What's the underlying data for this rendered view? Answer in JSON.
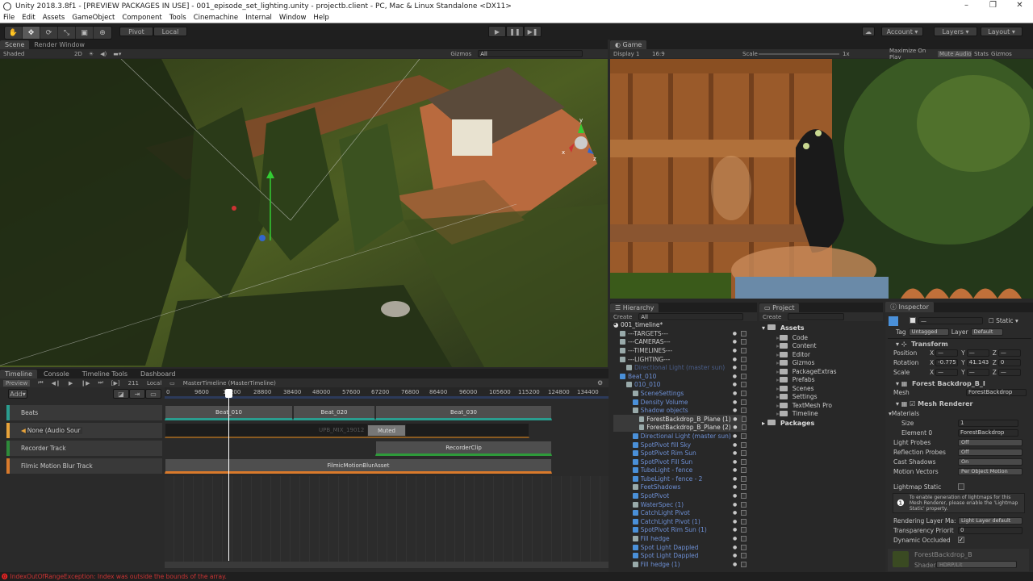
{
  "window": {
    "title": "Unity 2018.3.8f1 - [PREVIEW PACKAGES IN USE] - 001_episode_set_lighting.unity - projectb.client - PC, Mac & Linux Standalone <DX11>",
    "controls": [
      "–",
      "❐",
      "✕"
    ]
  },
  "menu": [
    "File",
    "Edit",
    "Assets",
    "GameObject",
    "Component",
    "Tools",
    "Cinemachine",
    "Internal",
    "Window",
    "Help"
  ],
  "toolbar": {
    "tools": [
      "hand",
      "move",
      "rotate",
      "scale",
      "rect",
      "transform"
    ],
    "pivot": "Pivot",
    "local": "Local",
    "play_buttons": [
      "▶",
      "❚❚",
      "▶❚"
    ],
    "account": "Account",
    "layers": "Layers",
    "layout": "Layout"
  },
  "scene": {
    "tabs": [
      "Scene",
      "Render Window"
    ],
    "shading": "Shaded",
    "mode_2d": "2D",
    "gizmos": "Gizmos",
    "search": "All",
    "axis": {
      "x": "x",
      "y": "y",
      "z": "z"
    }
  },
  "game": {
    "tab": "Game",
    "display": "Display 1",
    "aspect": "16:9",
    "scale_label": "Scale",
    "scale_value": "1x",
    "buttons": [
      "Maximize On Play",
      "Mute Audio",
      "Stats",
      "Gizmos"
    ]
  },
  "timeline": {
    "tabs": [
      "Timeline",
      "Console",
      "Timeline Tools",
      "Dashboard"
    ],
    "preview": "Preview",
    "frame": "211",
    "local": "Local",
    "asset": "MasterTimeline (MasterTimeline)",
    "add": "Add",
    "ruler": [
      "0",
      "9600",
      "19200",
      "28800",
      "38400",
      "48000",
      "57600",
      "67200",
      "76800",
      "86400",
      "96000",
      "105600",
      "115200",
      "124800",
      "134400"
    ],
    "tracks": [
      {
        "name": "Beats",
        "color": "#2a9d8f"
      },
      {
        "name": "None (Audio Sour",
        "color": "#e8a33a"
      },
      {
        "name": "Recorder Track",
        "color": "#2e8b3a"
      },
      {
        "name": "Filmic Motion Blur Track",
        "color": "#d97a2b"
      }
    ],
    "clips": {
      "beats": [
        "Beat_010",
        "Beat_020",
        "Beat_030"
      ],
      "audio": "UPB_MIX_19012",
      "muted": "Muted",
      "recorder": "RecorderClip",
      "blur": "FilmicMotionBlurAsset"
    }
  },
  "hierarchy": {
    "tab": "Hierarchy",
    "create": "Create",
    "search": "All",
    "scene": "001_timeline*",
    "items": [
      {
        "label": "---TARGETS---",
        "indent": 1,
        "style": "grey"
      },
      {
        "label": "---CAMERAS---",
        "indent": 1,
        "style": "grey"
      },
      {
        "label": "---TIMELINES---",
        "indent": 1,
        "style": "grey"
      },
      {
        "label": "---LIGHTING---",
        "indent": 1,
        "style": "grey"
      },
      {
        "label": "Directional Light (master sun)",
        "indent": 2,
        "style": "dim"
      },
      {
        "label": "Beat_010",
        "indent": 1,
        "style": "blue"
      },
      {
        "label": "010_010",
        "indent": 2,
        "style": "blue"
      },
      {
        "label": "SceneSettings",
        "indent": 3,
        "style": "blue"
      },
      {
        "label": "Density Volume",
        "indent": 3,
        "style": "blue"
      },
      {
        "label": "Shadow objects",
        "indent": 3,
        "style": "blue"
      },
      {
        "label": "ForestBackdrop_B_Plane (1)",
        "indent": 4,
        "style": "white"
      },
      {
        "label": "ForestBackdrop_B_Plane (2)",
        "indent": 4,
        "style": "white"
      },
      {
        "label": "Directional Light (master sun)",
        "indent": 3,
        "style": "blue"
      },
      {
        "label": "SpotPivot fill Sky",
        "indent": 3,
        "style": "blue"
      },
      {
        "label": "SpotPivot Rim Sun",
        "indent": 3,
        "style": "blue"
      },
      {
        "label": "SpotPivot Fill Sun",
        "indent": 3,
        "style": "blue"
      },
      {
        "label": "TubeLight - fence",
        "indent": 3,
        "style": "blue"
      },
      {
        "label": "TubeLight - fence - 2",
        "indent": 3,
        "style": "blue"
      },
      {
        "label": "FeetShadows",
        "indent": 3,
        "style": "blue"
      },
      {
        "label": "SpotPivot",
        "indent": 3,
        "style": "blue"
      },
      {
        "label": "WaterSpec (1)",
        "indent": 3,
        "style": "blue"
      },
      {
        "label": "CatchLight Pivot",
        "indent": 3,
        "style": "blue"
      },
      {
        "label": "CatchLight Pivot (1)",
        "indent": 3,
        "style": "blue"
      },
      {
        "label": "SpotPivot Rim Sun (1)",
        "indent": 3,
        "style": "blue"
      },
      {
        "label": "Fill hedge",
        "indent": 3,
        "style": "blue"
      },
      {
        "label": "Spot Light Dappled",
        "indent": 3,
        "style": "blue"
      },
      {
        "label": "Spot Light Dappled",
        "indent": 3,
        "style": "blue"
      },
      {
        "label": "Fill hedge (1)",
        "indent": 3,
        "style": "blue"
      }
    ]
  },
  "project": {
    "tab": "Project",
    "create": "Create",
    "root": "Assets",
    "folders": [
      "Code",
      "Content",
      "Editor",
      "Gizmos",
      "PackageExtras",
      "Prefabs",
      "Scenes",
      "Settings",
      "TextMesh Pro",
      "Timeline"
    ],
    "packages": "Packages"
  },
  "inspector": {
    "tab": "Inspector",
    "name": "—",
    "static": "Static",
    "tag_label": "Tag",
    "tag": "Untagged",
    "layer_label": "Layer",
    "layer": "Default",
    "transform": {
      "title": "Transform",
      "position": {
        "label": "Position",
        "x": "—",
        "y": "—",
        "z": "—"
      },
      "rotation": {
        "label": "Rotation",
        "x": "-0.775",
        "y": "41.143",
        "z": "0"
      },
      "scale": {
        "label": "Scale",
        "x": "—",
        "y": "—",
        "z": "—"
      }
    },
    "mesh_filter": {
      "title": "Forest Backdrop_B_I",
      "mesh_label": "Mesh",
      "mesh": "ForestBackdrop"
    },
    "mesh_renderer": {
      "title": "Mesh Renderer",
      "materials": "Materials",
      "size_label": "Size",
      "size": "1",
      "element0_label": "Element 0",
      "element0": "ForestBackdrop",
      "light_probes_label": "Light Probes",
      "light_probes": "Off",
      "reflection_probes_label": "Reflection Probes",
      "reflection_probes": "Off",
      "cast_shadows_label": "Cast Shadows",
      "cast_shadows": "On",
      "motion_vectors_label": "Motion Vectors",
      "motion_vectors": "Per Object Motion",
      "lightmap_static_label": "Lightmap Static",
      "help": "To enable generation of lightmaps for this Mesh Renderer, please enable the 'Lightmap Static' property.",
      "rendering_layer_label": "Rendering Layer Ma:",
      "rendering_layer": "Light Layer default",
      "transparency_label": "Transparency Priorit",
      "transparency": "0",
      "dynamic_occluded_label": "Dynamic Occluded"
    },
    "material": {
      "name": "ForestBackdrop_B",
      "shader_label": "Shader",
      "shader": "HDRP/Lit"
    }
  },
  "status": {
    "error": "IndexOutOfRangeException: Index was outside the bounds of the array."
  }
}
